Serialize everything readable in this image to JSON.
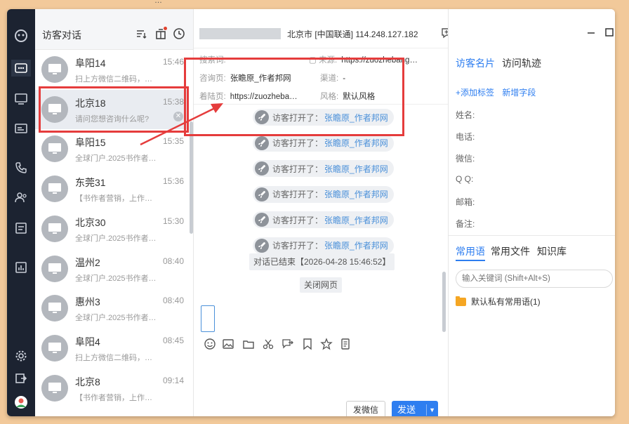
{
  "top_strip_text": "…",
  "conv_header": {
    "title": "访客对话"
  },
  "conversations": [
    {
      "name": "阜阳14",
      "time": "15:46",
      "preview": "扫上方微信二维码，…"
    },
    {
      "name": "北京18",
      "time": "15:38",
      "preview": "请问您想咨询什么呢?"
    },
    {
      "name": "阜阳15",
      "time": "15:35",
      "preview": "全球门户.2025书作者…"
    },
    {
      "name": "东莞31",
      "time": "15:36",
      "preview": "【书作者营销，上作…"
    },
    {
      "name": "北京30",
      "time": "15:30",
      "preview": "全球门户.2025书作者…"
    },
    {
      "name": "温州2",
      "time": "08:40",
      "preview": "全球门户.2025书作者…"
    },
    {
      "name": "惠州3",
      "time": "08:40",
      "preview": "全球门户.2025书作者…"
    },
    {
      "name": "阜阳4",
      "time": "08:45",
      "preview": "扫上方微信二维码，…"
    },
    {
      "name": "北京8",
      "time": "09:14",
      "preview": "【书作者营销，上作…"
    }
  ],
  "selected_index": 1,
  "chat_header": {
    "location": "北京市 [中国联通] 114.248.127.182"
  },
  "visit_info": {
    "search_label": "搜索词:",
    "search_value": "",
    "source_label": "来源:",
    "source_value": "https://zuozhebang…",
    "consult_label": "咨询页:",
    "consult_value": "张瞻原_作者邦网",
    "channel_label": "渠道:",
    "channel_value": "-",
    "landing_label": "着陆页:",
    "landing_value": "https://zuozheba…",
    "style_label": "风格:",
    "style_value": "默认风格"
  },
  "system_messages": [
    {
      "prefix": "访客打开了：",
      "link": "张瞻原_作者邦网"
    },
    {
      "prefix": "访客打开了：",
      "link": "张瞻原_作者邦网"
    },
    {
      "prefix": "访客打开了：",
      "link": "张瞻原_作者邦网"
    },
    {
      "prefix": "访客打开了：",
      "link": "张瞻原_作者邦网"
    },
    {
      "prefix": "访客打开了：",
      "link": "张瞻原_作者邦网"
    },
    {
      "prefix": "访客打开了：",
      "link": "张瞻原_作者邦网"
    }
  ],
  "conversation_ended": "对话已结束【2026-04-28 15:46:52】",
  "close_page_button": "关闭网页",
  "buttons": {
    "wechat": "发微信",
    "send": "发送"
  },
  "right_panel": {
    "tab_card": "访客名片",
    "tab_track": "访问轨迹",
    "add_tag": "+添加标签",
    "add_field": "新增字段",
    "fields": [
      "姓名:",
      "电话:",
      "微信:",
      "Q Q:",
      "邮箱:",
      "备注:"
    ],
    "tab_phrases": "常用语",
    "tab_files": "常用文件",
    "tab_kb": "知识库",
    "keyword_placeholder": "输入关键词 (Shift+Alt+S)",
    "folder": "默认私有常用语(1)"
  },
  "colors": {
    "accent": "#2e7ef0",
    "rail": "#1c2331",
    "annotation": "#e53c3c",
    "background": "#f2c99a"
  }
}
